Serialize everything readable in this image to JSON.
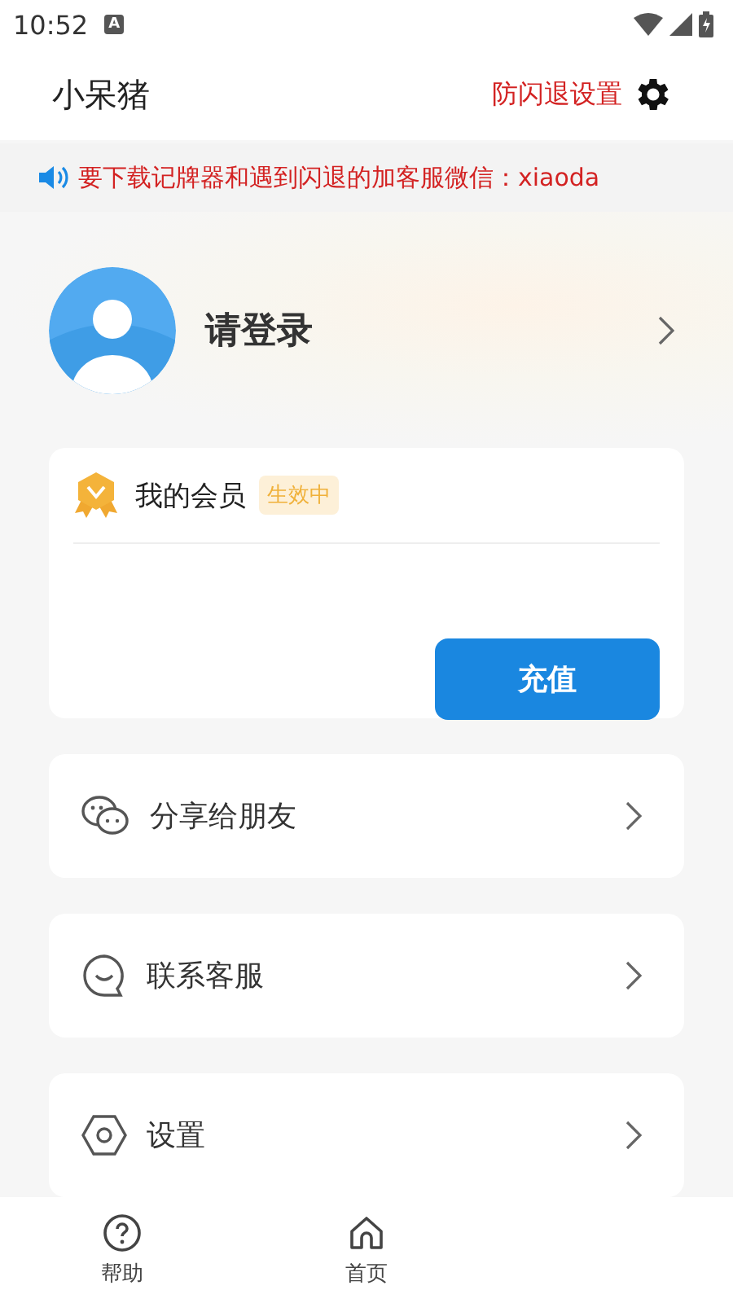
{
  "status_bar": {
    "time": "10:52",
    "notification": "A"
  },
  "app_bar": {
    "title": "小呆猪",
    "action": "防闪退设置"
  },
  "notice": {
    "text": "要下载记牌器和遇到闪退的加客服微信：xiaoda"
  },
  "profile": {
    "name": "请登录"
  },
  "membership": {
    "title": "我的会员",
    "status": "生效中",
    "button": "充值"
  },
  "menu": [
    {
      "kind": "share",
      "label": "分享给朋友"
    },
    {
      "kind": "service",
      "label": "联系客服"
    },
    {
      "kind": "settings",
      "label": "设置"
    }
  ],
  "tabs": [
    {
      "kind": "help",
      "label": "帮助",
      "selected": false
    },
    {
      "kind": "home",
      "label": "首页",
      "selected": false
    }
  ]
}
